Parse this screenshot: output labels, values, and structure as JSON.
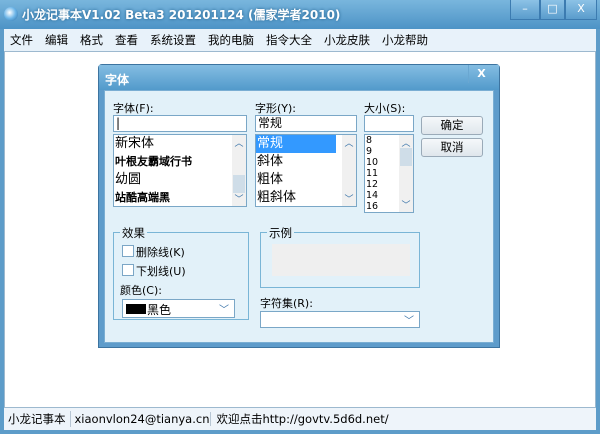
{
  "window": {
    "title": "小龙记事本V1.02 Beta3 201201124 (儒家学者2010)",
    "minimize": "–",
    "maximize": "□",
    "close": "X"
  },
  "menu": [
    "文件",
    "编辑",
    "格式",
    "查看",
    "系统设置",
    "我的电脑",
    "指令大全",
    "小龙皮肤",
    "小龙帮助"
  ],
  "dialog": {
    "title": "字体",
    "close": "X",
    "font_label": "字体(F):",
    "font_value": "|",
    "fonts": [
      "新宋体",
      "叶根友霸域行书",
      "幼圆",
      "站酷高端黑"
    ],
    "style_label": "字形(Y):",
    "style_value": "常规",
    "styles": [
      "常规",
      "斜体",
      "粗体",
      "粗斜体"
    ],
    "size_label": "大小(S):",
    "size_value": "",
    "sizes": [
      "8",
      "9",
      "10",
      "11",
      "12",
      "14",
      "16"
    ],
    "ok": "确定",
    "cancel": "取消",
    "effects_title": "效果",
    "strikeout": "删除线(K)",
    "underline": "下划线(U)",
    "color_label": "颜色(C):",
    "color_value": "黑色",
    "color_swatch": "#000000",
    "sample_title": "示例",
    "charset_label": "字符集(R):",
    "charset_value": ""
  },
  "status": {
    "app": "小龙记事本",
    "email": "xiaonvlon24@tianya.cn",
    "link": "欢迎点击http://govtv.5d6d.net/"
  }
}
